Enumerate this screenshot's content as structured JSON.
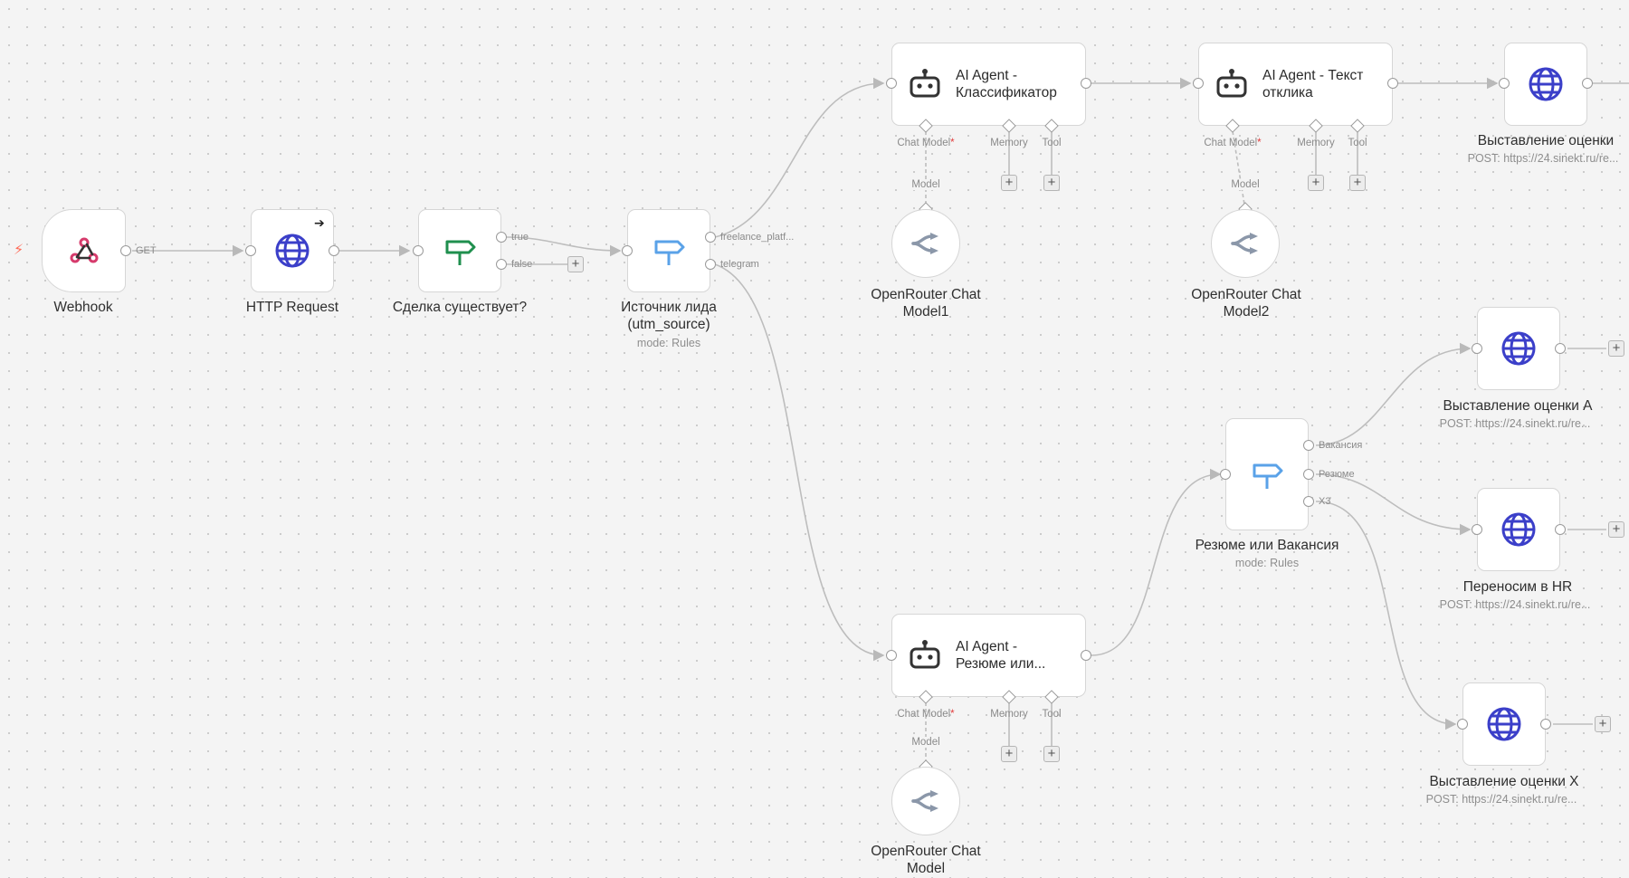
{
  "nodes": {
    "webhook": {
      "label": "Webhook",
      "icon": "webhook-icon",
      "output": "GET"
    },
    "http_request": {
      "label": "HTTP Request",
      "icon": "globe-icon"
    },
    "deal_exists": {
      "label": "Сделка существует?",
      "icon": "signpost-icon",
      "outputs": [
        "true",
        "false"
      ]
    },
    "lead_source": {
      "label_line1": "Источник лида",
      "label_line2": "(utm_source)",
      "subtitle": "mode: Rules",
      "icon": "signpost-icon",
      "outputs": [
        "freelance_platf...",
        "telegram"
      ]
    },
    "agent_classifier": {
      "title_line1": "AI Agent -",
      "title_line2": "Классификатор",
      "icon": "robot-icon"
    },
    "agent_reply": {
      "title_line1": "AI Agent - Текст",
      "title_line2": "отклика",
      "icon": "robot-icon"
    },
    "agent_resume": {
      "title_line1": "AI Agent -",
      "title_line2": "Резюме или...",
      "icon": "robot-icon"
    },
    "openrouter1": {
      "label_line1": "OpenRouter Chat",
      "label_line2": "Model1",
      "icon": "openrouter-icon"
    },
    "openrouter2": {
      "label_line1": "OpenRouter Chat",
      "label_line2": "Model2",
      "icon": "openrouter-icon"
    },
    "openrouter": {
      "label_line1": "OpenRouter Chat",
      "label_line2": "Model",
      "icon": "openrouter-icon"
    },
    "rating": {
      "label": "Выставление оценки",
      "subtitle": "POST: https://24.sinekt.ru/re...",
      "icon": "globe-icon"
    },
    "rating_a": {
      "label": "Выставление оценки А",
      "subtitle": "POST: https://24.sinekt.ru/re...",
      "icon": "globe-icon"
    },
    "to_hr": {
      "label": "Переносим в HR",
      "subtitle": "POST: https://24.sinekt.ru/re...",
      "icon": "globe-icon"
    },
    "rating_x": {
      "label": "Выставление оценки Х",
      "subtitle": "POST: https://24.sinekt.ru/re...",
      "icon": "globe-icon"
    },
    "resume_or_vacancy": {
      "label": "Резюме или Вакансия",
      "subtitle": "mode: Rules",
      "icon": "signpost-icon",
      "outputs": [
        "Вакансия",
        "Резюме",
        "Х3"
      ]
    }
  },
  "agent_ports": {
    "chat_model": "Chat Model",
    "required_mark": "*",
    "memory": "Memory",
    "tool": "Tool",
    "model": "Model"
  },
  "add_symbol": "+",
  "colors": {
    "edge": "#b9b9b9",
    "globe": "#3b3fc9",
    "signpost_green": "#1f8f4e",
    "signpost_blue": "#5aa2e8",
    "webhook": "#d63b6c",
    "trigger_bolt": "#ff6d5a",
    "openrouter": "#8b97a9"
  }
}
